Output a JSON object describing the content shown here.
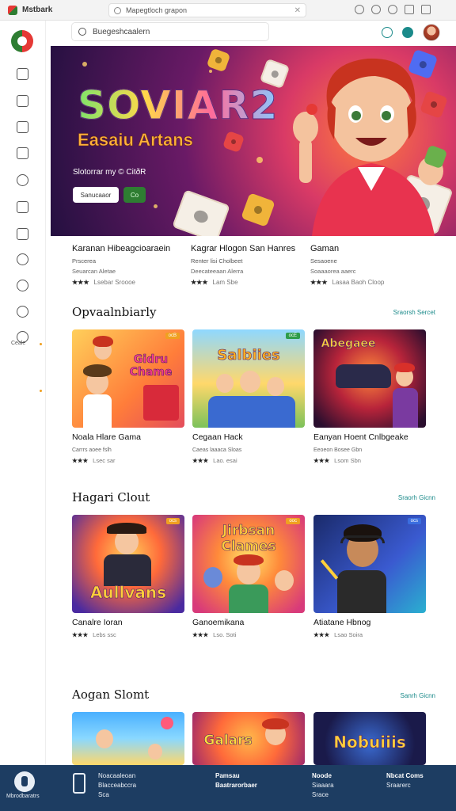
{
  "browser": {
    "brand": "Mstbark",
    "url": "Mapegtloch grapon"
  },
  "sidebar": {
    "label": "Ceale"
  },
  "search": {
    "placeholder": "Buegeshcaalern"
  },
  "hero": {
    "title": "SOVIAR2",
    "subtitle": "Easaiu Artans",
    "meta": "Slotorrar my © CitðR",
    "primary_button": "Sanucaaor",
    "secondary_button": "Co"
  },
  "featured": [
    {
      "title": "Karanan Hibeagcioaraein",
      "line1": "Prscerea",
      "line2": "Seuarcan Aletae",
      "stars": "★★★",
      "meta": "Lsebar Sroooe"
    },
    {
      "title": "Kagrar Hlogon San Hanres",
      "line1": "Renter lisi Cholbeet",
      "line2": "Deecateeaan Alerra",
      "stars": "★★★",
      "meta": "Lam Sbe"
    },
    {
      "title": "Gaman",
      "line1": "Sesaoene",
      "line2": "Soaaaorea aaerc",
      "stars": "★★★",
      "meta": "Lasaa Baoh Cloop"
    }
  ],
  "sections": [
    {
      "title": "Opvaalnbiarly",
      "see_all": "Sraorsh Sercet",
      "cards": [
        {
          "title": "Noala Hlare Gama",
          "thumb_text": "Gidru Chame",
          "badge": "ocB",
          "sub": "Carrrs aoee fslh",
          "stars": "★★★",
          "meta": "Lsec sar"
        },
        {
          "title": "Cegaan Hack",
          "thumb_text": "Salbiies",
          "badge": "ocE",
          "sub": "Caeas laaaca Sloas",
          "stars": "★★★",
          "meta": "Lao. esai"
        },
        {
          "title": "Eanyan Hoent Cnlbgeake",
          "thumb_text": "Abegaee",
          "badge": "",
          "sub": "Eeoeon Bosee Gbn",
          "stars": "★★★",
          "meta": "Lsom Sbn"
        }
      ]
    },
    {
      "title": "Hagari Clout",
      "see_all": "Sraorh Gicnn",
      "cards": [
        {
          "title": "Canalre Ioran",
          "thumb_text": "Aullvans",
          "badge": "ocs",
          "sub": "",
          "stars": "★★★",
          "meta": "Lebs ssc"
        },
        {
          "title": "Ganoemikana",
          "thumb_text": "Jirbsan Clames",
          "badge": "ooc",
          "sub": "",
          "stars": "★★★",
          "meta": "Lso. Soti"
        },
        {
          "title": "Atiatane Hbnog",
          "thumb_text": "",
          "badge": "ocs",
          "sub": "",
          "stars": "★★★",
          "meta": "Lsao Soira"
        }
      ]
    },
    {
      "title": "Aogan Slomt",
      "see_all": "Sanrh Gicnn",
      "cards": [
        {
          "title": "",
          "thumb_text": "",
          "badge": "",
          "sub": "",
          "stars": "",
          "meta": ""
        },
        {
          "title": "",
          "thumb_text": "Galars",
          "badge": "",
          "sub": "",
          "stars": "",
          "meta": ""
        },
        {
          "title": "",
          "thumb_text": "Nobuiiis",
          "badge": "",
          "sub": "",
          "stars": "",
          "meta": ""
        }
      ]
    }
  ],
  "footer": {
    "label": "Mbrodbaratrs",
    "col1": [
      "Noacaaleoan",
      "Blacceabccra",
      "Sca"
    ],
    "col2": [
      "Pamsau",
      "Baatrarorbaer"
    ],
    "col3": [
      "Noode",
      "Siaaara",
      "Srace"
    ],
    "col4": [
      "Nbcat Coms",
      "Sraarerc"
    ]
  }
}
